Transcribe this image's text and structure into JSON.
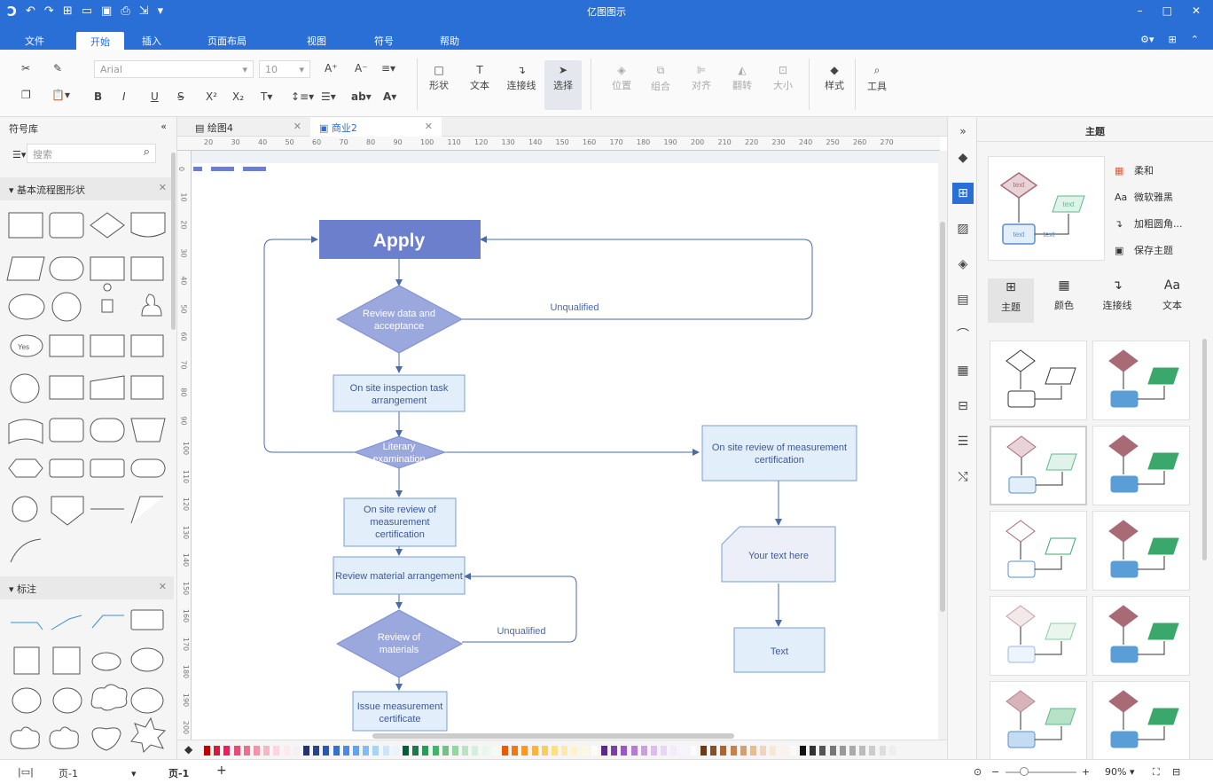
{
  "app": {
    "title": "亿图图示"
  },
  "menu": {
    "file": "文件",
    "start": "开始",
    "insert": "插入",
    "layout": "页面布局",
    "view": "视图",
    "symbol": "符号",
    "help": "帮助"
  },
  "ribbon": {
    "font_name": "Arial",
    "font_size": "10",
    "shape": "形状",
    "text": "文本",
    "connector": "连接线",
    "select": "选择",
    "position": "位置",
    "group": "组合",
    "align": "对齐",
    "flip": "翻转",
    "size": "大小",
    "style": "样式",
    "tools": "工具"
  },
  "left_panel": {
    "title": "符号库",
    "search_placeholder": "搜索",
    "section1": "基本流程图形状",
    "section2": "标注",
    "yes": "Yes"
  },
  "tabs": [
    {
      "label": "绘图4"
    },
    {
      "label": "商业2"
    }
  ],
  "ruler": [
    "20",
    "30",
    "40",
    "50",
    "60",
    "70",
    "80",
    "90",
    "100",
    "110",
    "120",
    "130",
    "140",
    "150",
    "160",
    "170",
    "180",
    "190",
    "200",
    "210",
    "220",
    "230",
    "240",
    "250",
    "260",
    "270"
  ],
  "vruler": [
    "0",
    "10",
    "20",
    "30",
    "40",
    "50",
    "60",
    "70",
    "80",
    "90",
    "100",
    "110",
    "120",
    "130",
    "140",
    "150",
    "160",
    "170",
    "180",
    "190",
    "200"
  ],
  "diagram": {
    "apply": "Apply",
    "review_data": [
      "Review data and",
      "acceptance"
    ],
    "unqualified1": "Unqualified",
    "inspection": [
      "On site inspection task",
      "arrangement"
    ],
    "literary": [
      "Literary",
      "examination"
    ],
    "onsite_right": [
      "On site review of measurement",
      "certification"
    ],
    "onsite_left": [
      "On site review of",
      "measurement",
      "certification"
    ],
    "your_text": "Your text here",
    "review_material": "Review material arrangement",
    "review_materials": [
      "Review of",
      "materials"
    ],
    "unqualified2": "Unqualified",
    "text_box": "Text",
    "issue": [
      "Issue measurement",
      "certificate"
    ]
  },
  "right_panel": {
    "title": "主题",
    "opt1": "柔和",
    "opt2": "微软雅黑",
    "opt3": "加粗圆角...",
    "opt4": "保存主题",
    "tab_theme": "主题",
    "tab_color": "颜色",
    "tab_connector": "连接线",
    "tab_text": "文本",
    "preview_text": "text"
  },
  "status": {
    "page_select": "页-1",
    "page_tab": "页-1",
    "add": "+",
    "zoom": "90%"
  },
  "colors": {
    "accent": "#2a6fd6",
    "apply_fill": "#6b7fcc",
    "diamond_fill": "#9aa8de",
    "box_fill": "#e3eefb",
    "box_stroke": "#7a9fd0",
    "connector": "#4a6aa8"
  },
  "palette": [
    "#c00000",
    "#d81b3c",
    "#e0245e",
    "#e84a7a",
    "#ef6d8f",
    "#f294a8",
    "#f7b6c4",
    "#fbd5dd",
    "#fde8ec",
    "#f5f0f2",
    "#27336b",
    "#2c4289",
    "#2f56a8",
    "#3a6fc9",
    "#4b8ae0",
    "#62a3ea",
    "#80bdf2",
    "#a6d3f6",
    "#cbe6fa",
    "#e7f3fd",
    "#0a5a3a",
    "#1b7a4a",
    "#2c9a58",
    "#45b26b",
    "#6cc583",
    "#94d6a1",
    "#b9e4c0",
    "#d6efdb",
    "#e8f6eb",
    "#f2fbf4",
    "#e65c00",
    "#f27a0b",
    "#f89a1f",
    "#fbb63a",
    "#fdcd5c",
    "#fee083",
    "#fdeaa9",
    "#fef3cb",
    "#fff8e1",
    "#fffdf3",
    "#5b2a86",
    "#7b3fa8",
    "#9a59c2",
    "#b57bd4",
    "#cb9ee3",
    "#dcbdee",
    "#e9d6f5",
    "#f3ebfa",
    "#f8f3fc",
    "#fcfafe",
    "#6b3a16",
    "#8a4e23",
    "#a86635",
    "#c3824d",
    "#d6a06e",
    "#e4bd95",
    "#efd6bb",
    "#f6e8d8",
    "#fbf3ea",
    "#fdf9f4",
    "#111111",
    "#333333",
    "#555555",
    "#777777",
    "#999999",
    "#aaaaaa",
    "#bbbbbb",
    "#cccccc",
    "#dddddd",
    "#eeeeee"
  ]
}
